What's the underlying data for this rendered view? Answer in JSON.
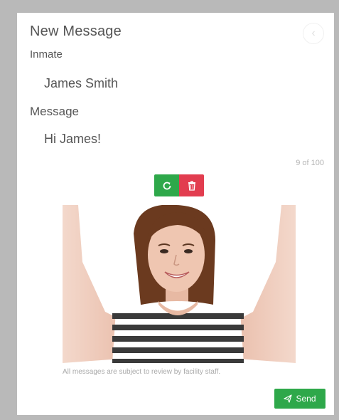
{
  "dialog": {
    "title": "New Message",
    "close_icon": "close-circle-icon"
  },
  "form": {
    "inmate_label": "Inmate",
    "inmate_value": "James Smith",
    "message_label": "Message",
    "message_value": "Hi James!",
    "char_count": "9 of 100"
  },
  "photo_actions": {
    "refresh_icon": "refresh-icon",
    "delete_icon": "trash-icon"
  },
  "photo": {
    "description_icon": "attached-photo"
  },
  "footer": {
    "disclaimer": "All messages are subject to review by facility staff.",
    "send_label": "Send",
    "send_icon": "paper-plane-icon"
  },
  "colors": {
    "accent_green": "#2ea84a",
    "danger_red": "#e23d4f",
    "frame_gray": "#b9b9b9"
  }
}
